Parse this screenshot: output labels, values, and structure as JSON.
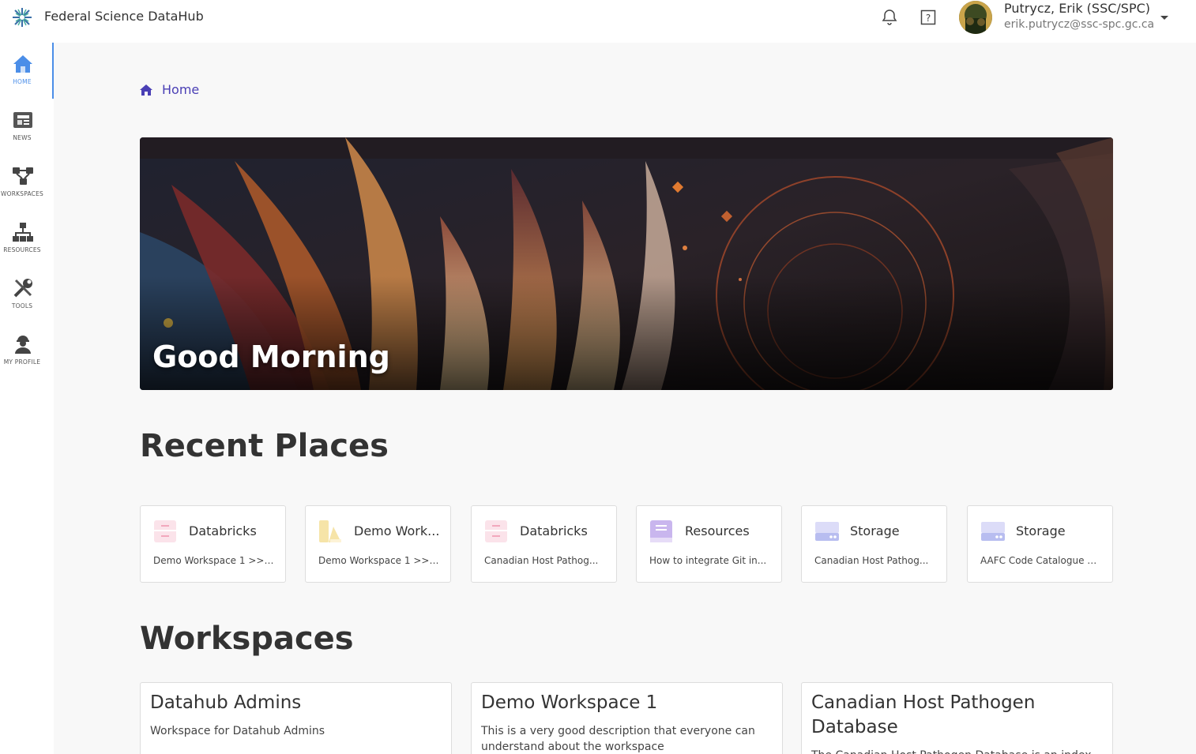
{
  "app": {
    "title": "Federal Science DataHub"
  },
  "user": {
    "name": "Putrycz, Erik (SSC/SPC)",
    "email": "erik.putrycz@ssc-spc.gc.ca"
  },
  "sidebar": {
    "items": [
      {
        "label": "HOME",
        "icon": "home-icon",
        "active": true
      },
      {
        "label": "NEWS",
        "icon": "news-icon"
      },
      {
        "label": "WORKSPACES",
        "icon": "workspaces-icon"
      },
      {
        "label": "RESOURCES",
        "icon": "resources-icon"
      },
      {
        "label": "TOOLS",
        "icon": "tools-icon"
      },
      {
        "label": "MY PROFILE",
        "icon": "profile-icon"
      }
    ]
  },
  "breadcrumb": {
    "label": "Home"
  },
  "hero": {
    "greeting": "Good Morning"
  },
  "recent": {
    "heading": "Recent Places",
    "items": [
      {
        "title": "Databricks",
        "subtitle": "Demo Workspace 1 >> ...",
        "icon": "databricks-icon"
      },
      {
        "title": "Demo Work...",
        "subtitle": "Demo Workspace 1 >> ...",
        "icon": "workspace-icon"
      },
      {
        "title": "Databricks",
        "subtitle": "Canadian Host Pathog...",
        "icon": "databricks-icon"
      },
      {
        "title": "Resources",
        "subtitle": "How to integrate Git in...",
        "icon": "resources-book-icon"
      },
      {
        "title": "Storage",
        "subtitle": "Canadian Host Pathog...",
        "icon": "storage-icon"
      },
      {
        "title": "Storage",
        "subtitle": "AAFC Code Catalogue >...",
        "icon": "storage-icon"
      }
    ]
  },
  "workspaces": {
    "heading": "Workspaces",
    "items": [
      {
        "title": "Datahub Admins",
        "description": "Workspace for Datahub Admins"
      },
      {
        "title": "Demo Workspace 1",
        "description": "This is a very good description that everyone can understand about the workspace"
      },
      {
        "title": "Canadian Host Pathogen Database",
        "description": "The Canadian Host Pathogen Database is an index of"
      }
    ]
  },
  "colors": {
    "accent": "#4b8ee8",
    "breadcrumb": "#4a3fb5"
  }
}
